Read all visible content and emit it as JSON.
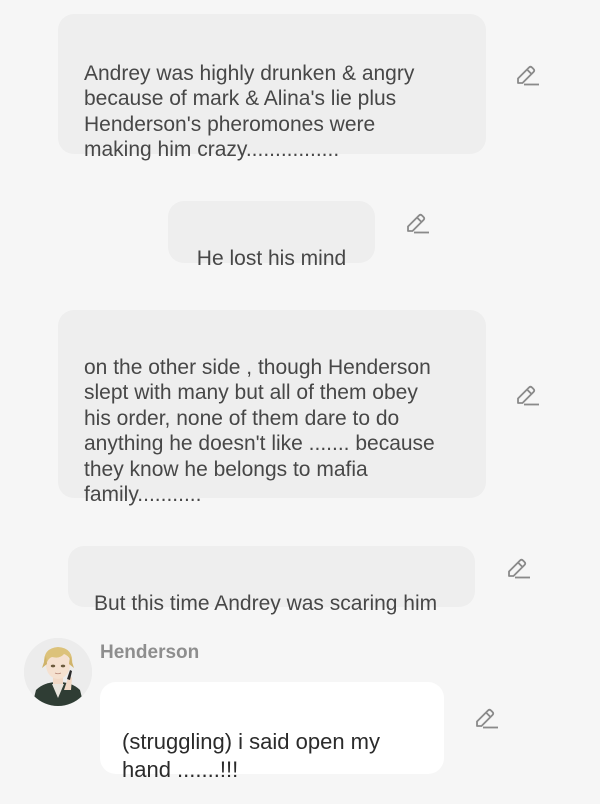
{
  "messages": [
    {
      "text": "Andrey was highly drunken & angry\nbecause of mark & Alina's lie  plus\nHenderson's pheromones  were\nmaking him crazy................"
    },
    {
      "text": "He lost his mind"
    },
    {
      "text": "on the other side , though Henderson\nslept with many but all of them obey\nhis order, none of them dare to do\nanything he doesn't like ....... because\nthey know he belongs to mafia\nfamily..........."
    },
    {
      "text": "But this time Andrey was scaring him"
    },
    {
      "speaker": "Henderson",
      "text": "(struggling) i said open my\nhand .......!!!"
    }
  ],
  "colors": {
    "background": "#f6f6f6",
    "narration_bubble": "#eeeeee",
    "dialogue_bubble": "#ffffff",
    "icon": "#8a8a8a"
  },
  "icons": {
    "edit": "pencil-edit-icon",
    "avatar": "character-avatar"
  }
}
